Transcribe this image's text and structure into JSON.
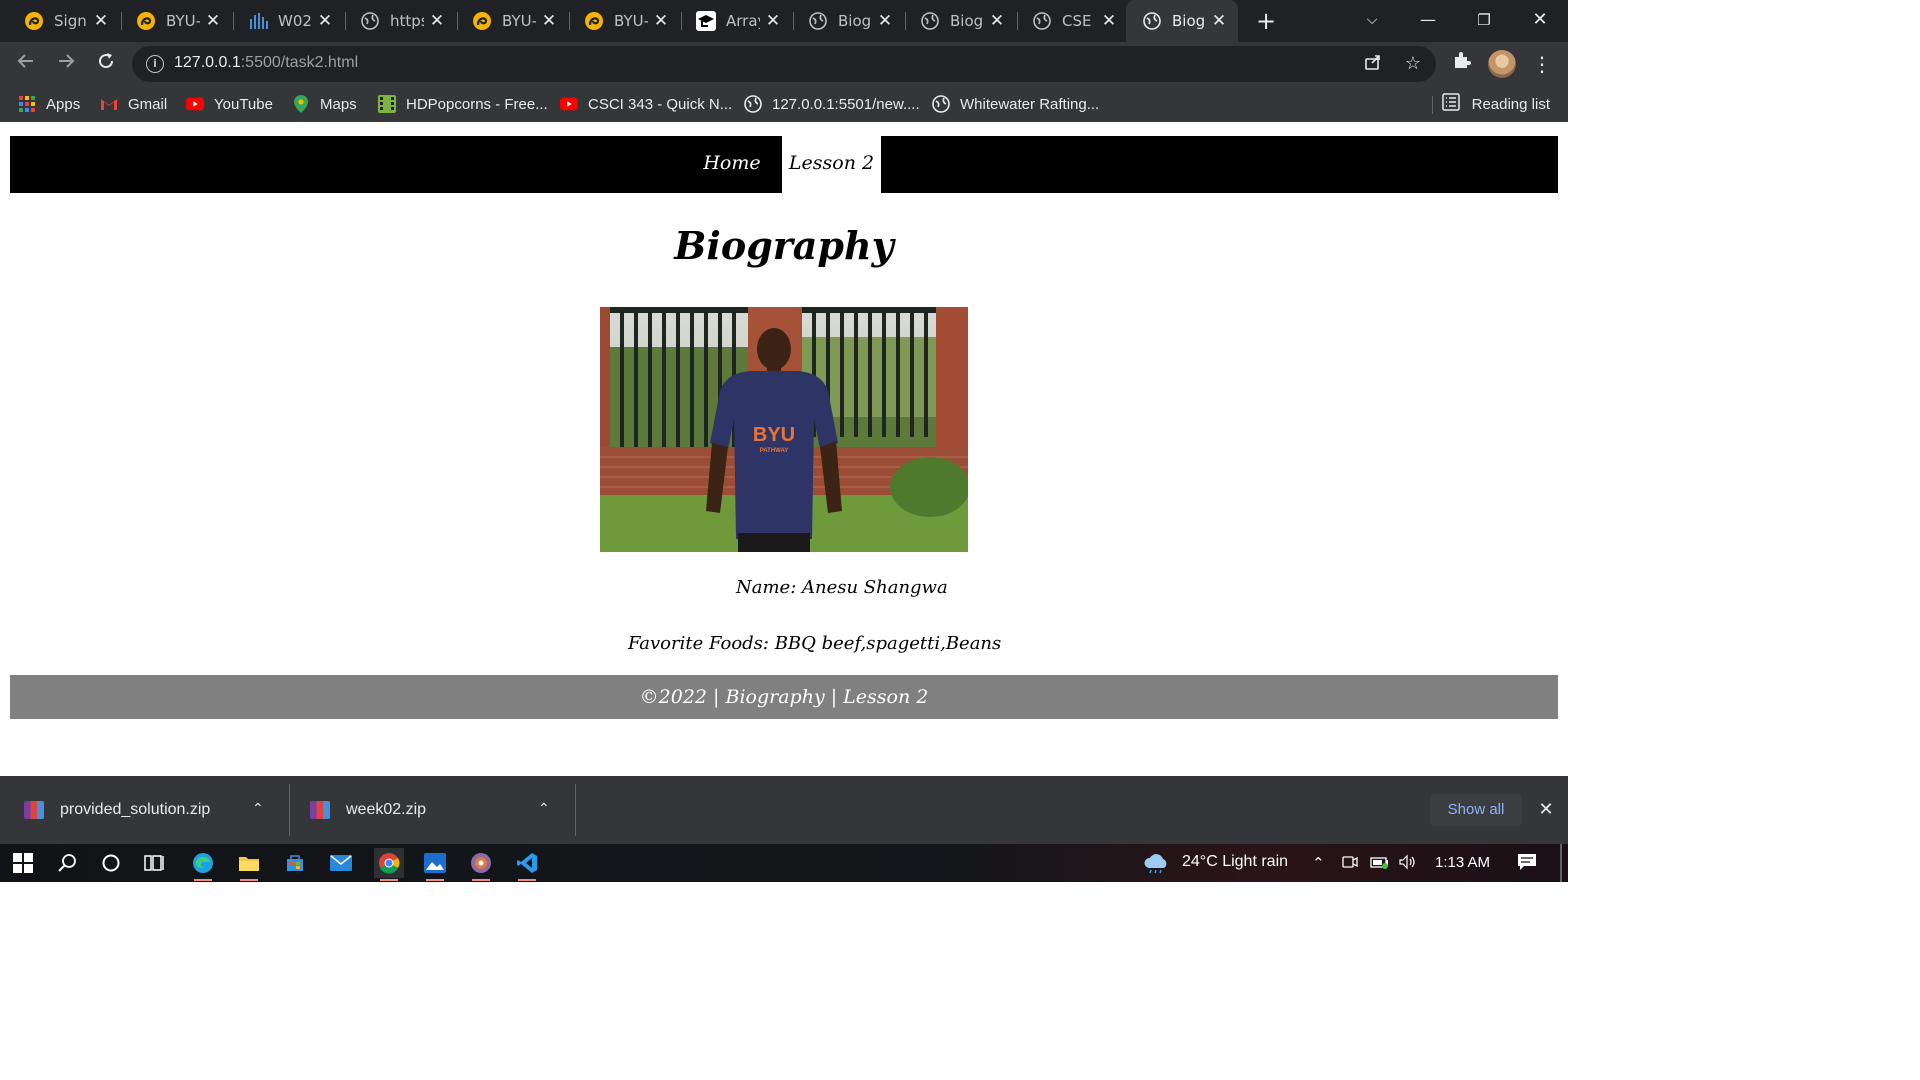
{
  "browser": {
    "tabs": [
      {
        "title": "Sign In",
        "favicon": "byu-logo-icon"
      },
      {
        "title": "BYU-Pathway",
        "favicon": "byu-logo-icon"
      },
      {
        "title": "W02",
        "favicon": "bars-logo-icon"
      },
      {
        "title": "https",
        "favicon": "globe-icon"
      },
      {
        "title": "BYU-Pathway",
        "favicon": "byu-logo-icon"
      },
      {
        "title": "BYU-Pathway",
        "favicon": "byu-logo-icon"
      },
      {
        "title": "Array",
        "favicon": "graduation-cap-icon"
      },
      {
        "title": "Biography",
        "favicon": "globe-icon"
      },
      {
        "title": "Biography",
        "favicon": "globe-icon"
      },
      {
        "title": "CSE",
        "favicon": "globe-icon"
      },
      {
        "title": "Biography",
        "favicon": "globe-icon",
        "active": true
      }
    ],
    "url_host": "127.0.0.1",
    "url_path": ":5500/task2.html",
    "bookmarks": [
      {
        "label": "Apps",
        "icon": "apps-grid-icon"
      },
      {
        "label": "Gmail",
        "icon": "gmail-icon"
      },
      {
        "label": "YouTube",
        "icon": "youtube-icon"
      },
      {
        "label": "Maps",
        "icon": "maps-pin-icon"
      },
      {
        "label": "HDPopcorns - Free...",
        "icon": "film-icon"
      },
      {
        "label": "CSCI 343 - Quick N...",
        "icon": "youtube-icon"
      },
      {
        "label": "127.0.0.1:5501/new....",
        "icon": "globe-icon"
      },
      {
        "label": "Whitewater Rafting...",
        "icon": "globe-icon"
      }
    ],
    "reading_list": "Reading list"
  },
  "site": {
    "nav": {
      "home": "Home",
      "lesson": "Lesson 2"
    },
    "title": "Biography",
    "name": "Name: Anesu Shangwa",
    "foods": "Favorite Foods: BBQ beef,spagetti,Beans",
    "footer": "©2022 | Biography | Lesson 2",
    "shirt_text": "BYU",
    "shirt_subtext": "PATHWAY"
  },
  "downloads": {
    "items": [
      "provided_solution.zip",
      "week02.zip"
    ],
    "show_all": "Show all"
  },
  "taskbar": {
    "weather": "24°C  Light rain",
    "time": "1:13 AM"
  },
  "colors": {
    "nav_bg": "#000000",
    "footer_bg": "#808080",
    "chrome_dark": "#202124",
    "chrome_toolbar": "#35363a",
    "link_blue": "#8ab4f8"
  }
}
